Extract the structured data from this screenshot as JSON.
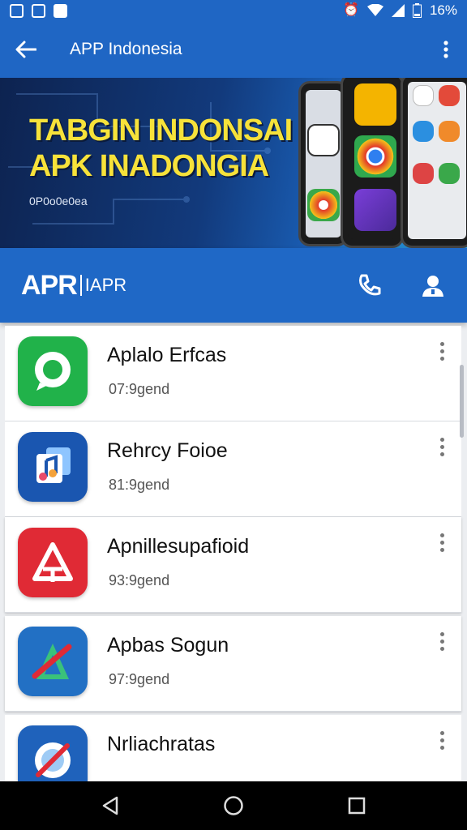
{
  "status_bar": {
    "battery_text": "16%",
    "left_icons": [
      "gallery-icon",
      "screenshot-icon",
      "photos-icon"
    ],
    "right_icons": [
      "alarm-icon",
      "wifi-icon",
      "signal-icon",
      "battery-icon"
    ]
  },
  "app_bar": {
    "title": "APP Indonesia",
    "back_icon": "arrow-left-icon",
    "menu_icon": "overflow-menu-icon"
  },
  "banner": {
    "line1": "TABGIN INDONSAI",
    "line2": "APK INADONGIA",
    "small_text": "0P0o0e0ea"
  },
  "brand_bar": {
    "logo": "APR",
    "subtitle": "IAPR",
    "actions": [
      "phone-icon",
      "account-icon"
    ]
  },
  "apps": [
    {
      "name": "Aplalo Erfcas",
      "meta": "07:9gend",
      "icon": "chat-icon",
      "color": "#21b24a"
    },
    {
      "name": "Rehrcy Foioe",
      "meta": "81:9gend",
      "icon": "music-icon",
      "color": "#1a56b0"
    },
    {
      "name": "Apnillesupafioid",
      "meta": "93:9gend",
      "icon": "a-logo-icon",
      "color": "#e02a35"
    },
    {
      "name": "Apbas Sogun",
      "meta": "97:9gend",
      "icon": "a-slash-icon",
      "color": "#2270c4"
    },
    {
      "name": "Nrliachratas",
      "meta": "",
      "icon": "blocked-icon",
      "color": "#1f62bb"
    }
  ],
  "nav": [
    "back-triangle-icon",
    "home-circle-icon",
    "recents-square-icon"
  ]
}
